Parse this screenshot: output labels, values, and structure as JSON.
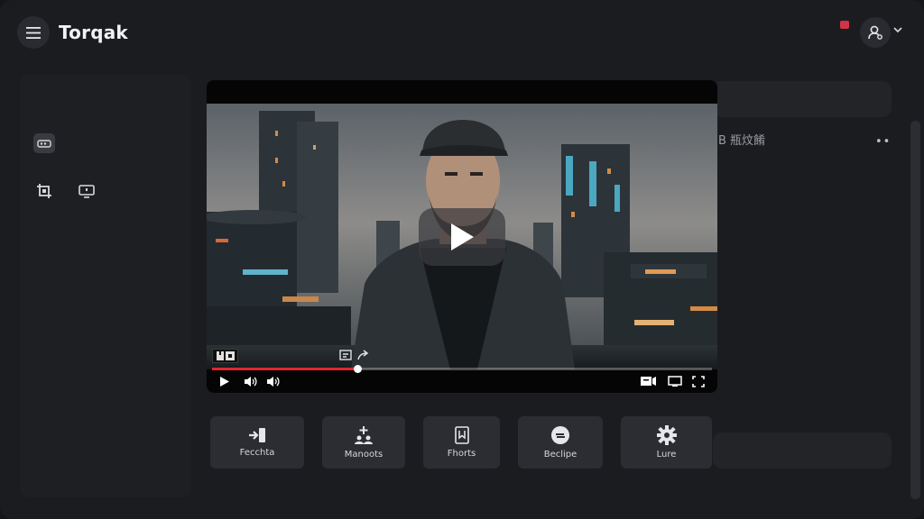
{
  "header": {
    "app_title": "Torqak",
    "menu_icon": "hamburger-menu-icon",
    "avatar_icon": "user-icon",
    "notification_color": "#d23346"
  },
  "sidebar": {
    "items": [
      {
        "icon": "library-icon",
        "active": true
      },
      {
        "icon": "crop-icon",
        "active": false
      },
      {
        "icon": "screen-icon",
        "active": false
      }
    ]
  },
  "right_panel": {
    "label": "B 瓶炆餚",
    "more": "••"
  },
  "player": {
    "badge": "HD",
    "progress_fraction": 0.29,
    "progress_color": "#e0272f",
    "controls": [
      "play-icon",
      "volume-icon",
      "volume-icon",
      "captions-icon",
      "miniplayer-icon",
      "fullscreen-icon"
    ]
  },
  "actions": [
    {
      "label": "Fecchta",
      "icon": "enter-icon"
    },
    {
      "label": "Manoots",
      "icon": "add-people-icon"
    },
    {
      "label": "Fhorts",
      "icon": "bookmark-icon"
    },
    {
      "label": "Beclipe",
      "icon": "circle-icon"
    },
    {
      "label": "Lure",
      "icon": "gear-icon"
    }
  ]
}
